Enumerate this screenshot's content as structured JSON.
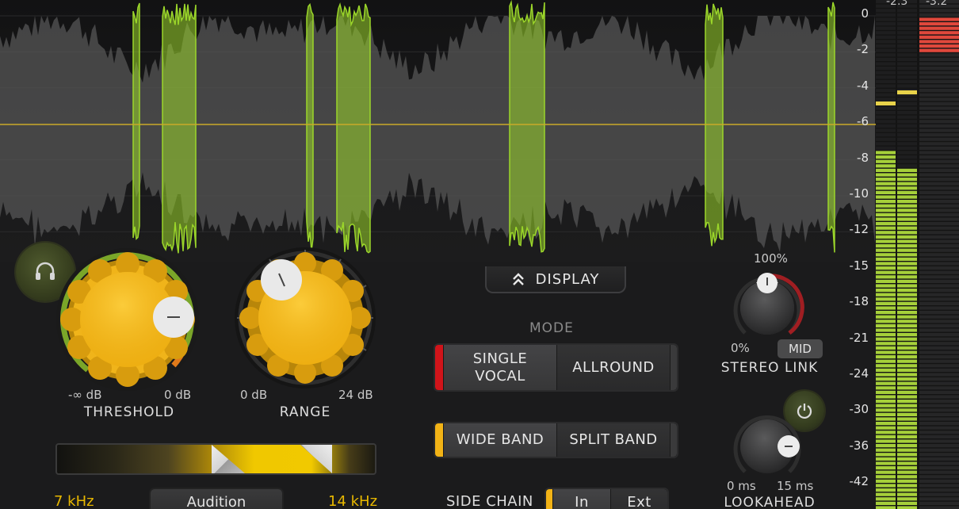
{
  "display": {
    "button_label": "DISPLAY",
    "scale_labels": [
      "0",
      "-2",
      "-4",
      "-6",
      "-8",
      "-10",
      "-12",
      "-15",
      "-18",
      "-21",
      "-24",
      "-30",
      "-36",
      "-42"
    ],
    "threshold_line_level_db": -6
  },
  "meters": {
    "left_peak": "-2.3",
    "right_peak": "-3.2"
  },
  "threshold": {
    "label": "THRESHOLD",
    "min_label": "-∞ dB",
    "max_label": "0 dB"
  },
  "range": {
    "label": "RANGE",
    "min_label": "0 dB",
    "max_label": "24 dB"
  },
  "mode": {
    "label": "MODE",
    "single_vocal_line1": "SINGLE",
    "single_vocal_line2": "VOCAL",
    "allround": "ALLROUND"
  },
  "band": {
    "wide_band": "WIDE BAND",
    "split_band": "SPLIT BAND"
  },
  "frequency": {
    "low_label": "7 kHz",
    "high_label": "14 kHz",
    "audition_label": "Audition"
  },
  "side_chain": {
    "label": "SIDE CHAIN",
    "in_label": "In",
    "ext_label": "Ext"
  },
  "stereo_link": {
    "label": "STEREO LINK",
    "max_label": "100%",
    "min_label": "0%",
    "mid_label": "MID"
  },
  "lookahead": {
    "label": "LOOKAHEAD",
    "min_label": "0 ms",
    "max_label": "15 ms"
  },
  "colors": {
    "accent_yellow": "#f2b316",
    "wave_green": "#9bd62a",
    "wave_gray": "#555556",
    "meter_green": "#a6d03a",
    "meter_red": "#e0483c",
    "indicator_red": "#d0141a"
  },
  "icons": {
    "headphones": "headphones-icon",
    "power": "power-icon",
    "display_toggle": "double-chevron-up-icon"
  }
}
